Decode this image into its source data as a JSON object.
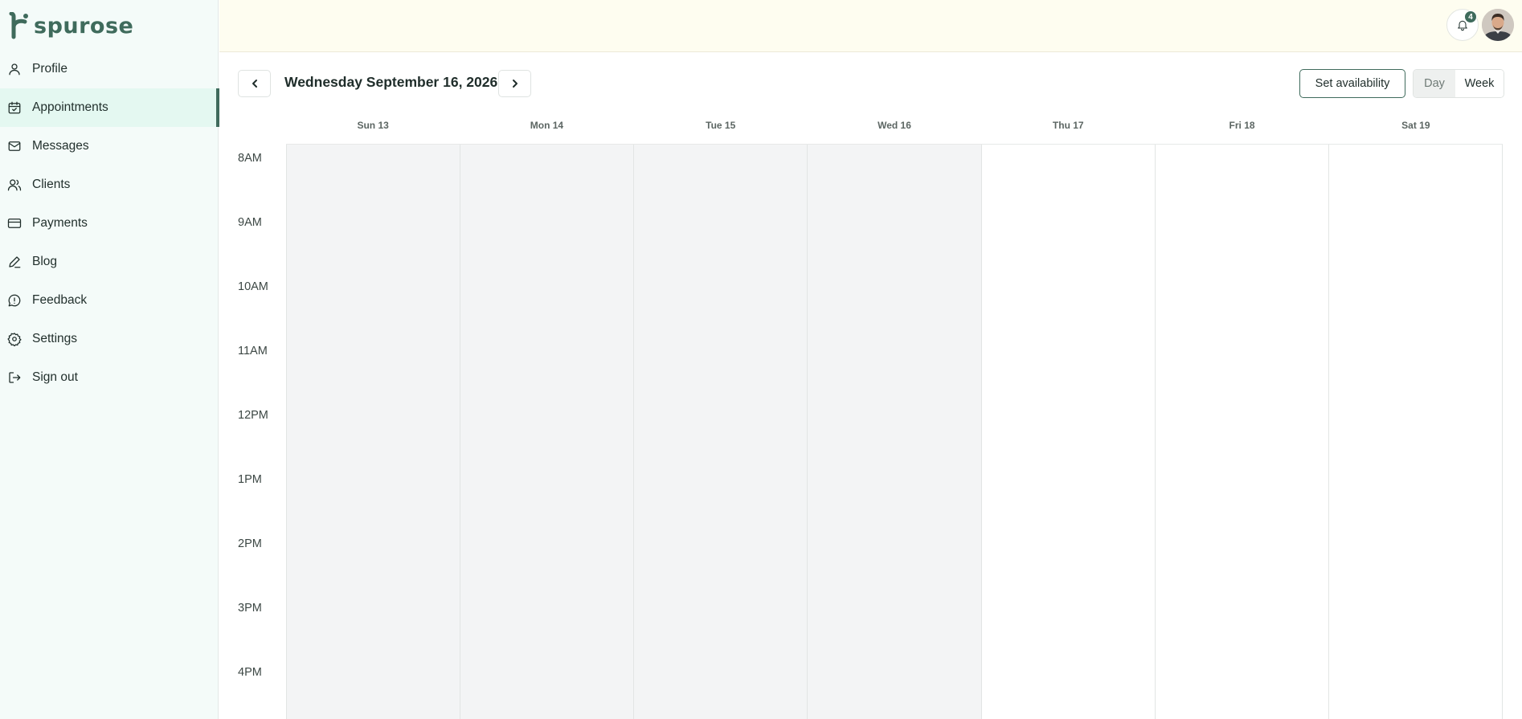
{
  "brand": {
    "name": "spurose",
    "color": "#3f6b5c"
  },
  "sidebar": {
    "items": [
      {
        "label": "Profile",
        "icon": "user-icon",
        "active": false
      },
      {
        "label": "Appointments",
        "icon": "calendar-icon",
        "active": true
      },
      {
        "label": "Messages",
        "icon": "mail-icon",
        "active": false
      },
      {
        "label": "Clients",
        "icon": "users-icon",
        "active": false
      },
      {
        "label": "Payments",
        "icon": "credit-card-icon",
        "active": false
      },
      {
        "label": "Blog",
        "icon": "pen-icon",
        "active": false
      },
      {
        "label": "Feedback",
        "icon": "message-alert-icon",
        "active": false
      },
      {
        "label": "Settings",
        "icon": "gear-icon",
        "active": false
      },
      {
        "label": "Sign out",
        "icon": "sign-out-icon",
        "active": false
      }
    ]
  },
  "topbar": {
    "notification_count": "4",
    "bell_icon": "bell-icon",
    "avatar": "user-avatar-photo"
  },
  "calendar": {
    "current_date": "Wednesday September 16, 2026",
    "set_availability_label": "Set availability",
    "view_day_label": "Day",
    "view_week_label": "Week",
    "selected_view": "Week",
    "days": [
      {
        "label": "Sun 13",
        "past": true
      },
      {
        "label": "Mon 14",
        "past": true
      },
      {
        "label": "Tue 15",
        "past": true
      },
      {
        "label": "Wed 16",
        "past": true
      },
      {
        "label": "Thu 17",
        "past": false
      },
      {
        "label": "Fri 18",
        "past": false
      },
      {
        "label": "Sat 19",
        "past": false
      }
    ],
    "times": [
      "8AM",
      "9AM",
      "10AM",
      "11AM",
      "12PM",
      "1PM",
      "2PM",
      "3PM",
      "4PM"
    ]
  },
  "colors": {
    "accent": "#3f6b5c",
    "sidebar_bg": "#f4fbf9",
    "active_item_bg": "#e4f8f1",
    "topbar_bg": "#fefdf0",
    "past_day_bg": "#f3f4f5"
  }
}
